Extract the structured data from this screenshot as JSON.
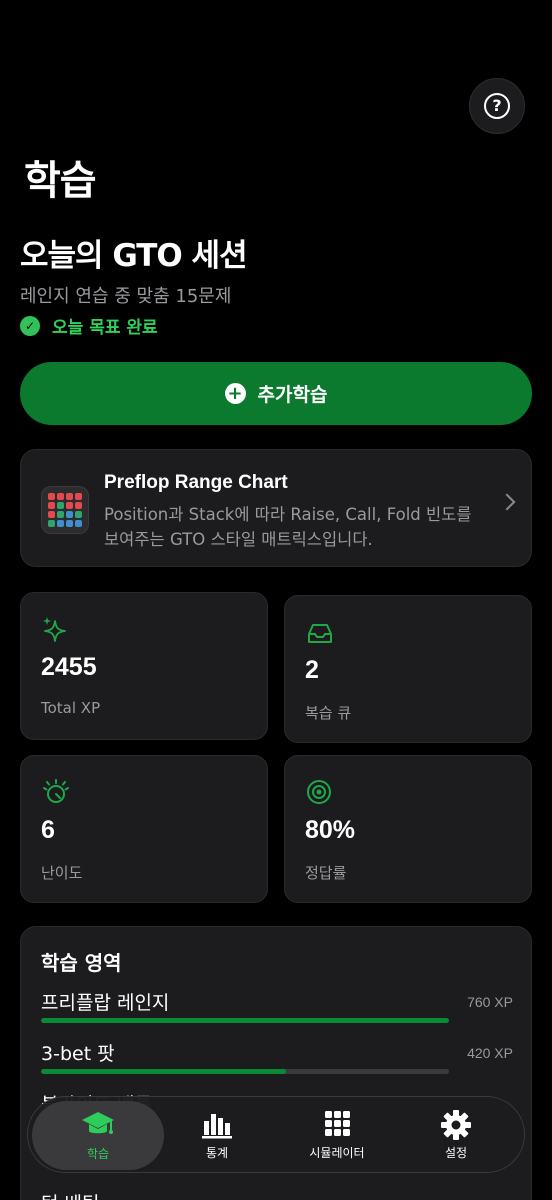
{
  "header": {
    "title": "학습",
    "help_glyph": "?"
  },
  "session": {
    "title": "오늘의 GTO 세션",
    "subtitle": "레인지 연습 중 맞춤 15문제",
    "goal_text": "오늘 목표 완료"
  },
  "cta": {
    "label": "추가학습"
  },
  "range_card": {
    "title": "Preflop Range Chart",
    "description": "Position과 Stack에 따라 Raise, Call, Fold 빈도를 보여주는 GTO 스타일 매트릭스입니다."
  },
  "stats": [
    {
      "icon": "sparkles-icon",
      "value": "2455",
      "label": "Total XP"
    },
    {
      "icon": "inbox-tray-icon",
      "value": "2",
      "label": "복습 큐"
    },
    {
      "icon": "gauge-dial-icon",
      "value": "6",
      "label": "난이도"
    },
    {
      "icon": "target-icon",
      "value": "80%",
      "label": "정답률"
    }
  ],
  "areas": {
    "title": "학습 영역",
    "items": [
      {
        "name": "프리플랍 레인지",
        "xp": "760 XP",
        "progress": 1.0
      },
      {
        "name": "3-bet 팟",
        "xp": "420 XP",
        "progress": 0.6
      },
      {
        "name": "블라인드 배틀",
        "xp": "",
        "progress": 0.0
      },
      {
        "name": "턴 베팅",
        "xp": "",
        "progress": 0.0
      }
    ]
  },
  "tabs": [
    {
      "label": "학습",
      "icon": "graduation-cap-icon",
      "active": true
    },
    {
      "label": "통계",
      "icon": "bar-chart-icon",
      "active": false
    },
    {
      "label": "시뮬레이터",
      "icon": "grid-icon",
      "active": false
    },
    {
      "label": "설정",
      "icon": "gear-icon",
      "active": false
    }
  ],
  "colors": {
    "accent": "#0b7a2f",
    "accent_text": "#30d158",
    "card_bg": "#1c1c1e",
    "muted_text": "#9a9a9e"
  }
}
